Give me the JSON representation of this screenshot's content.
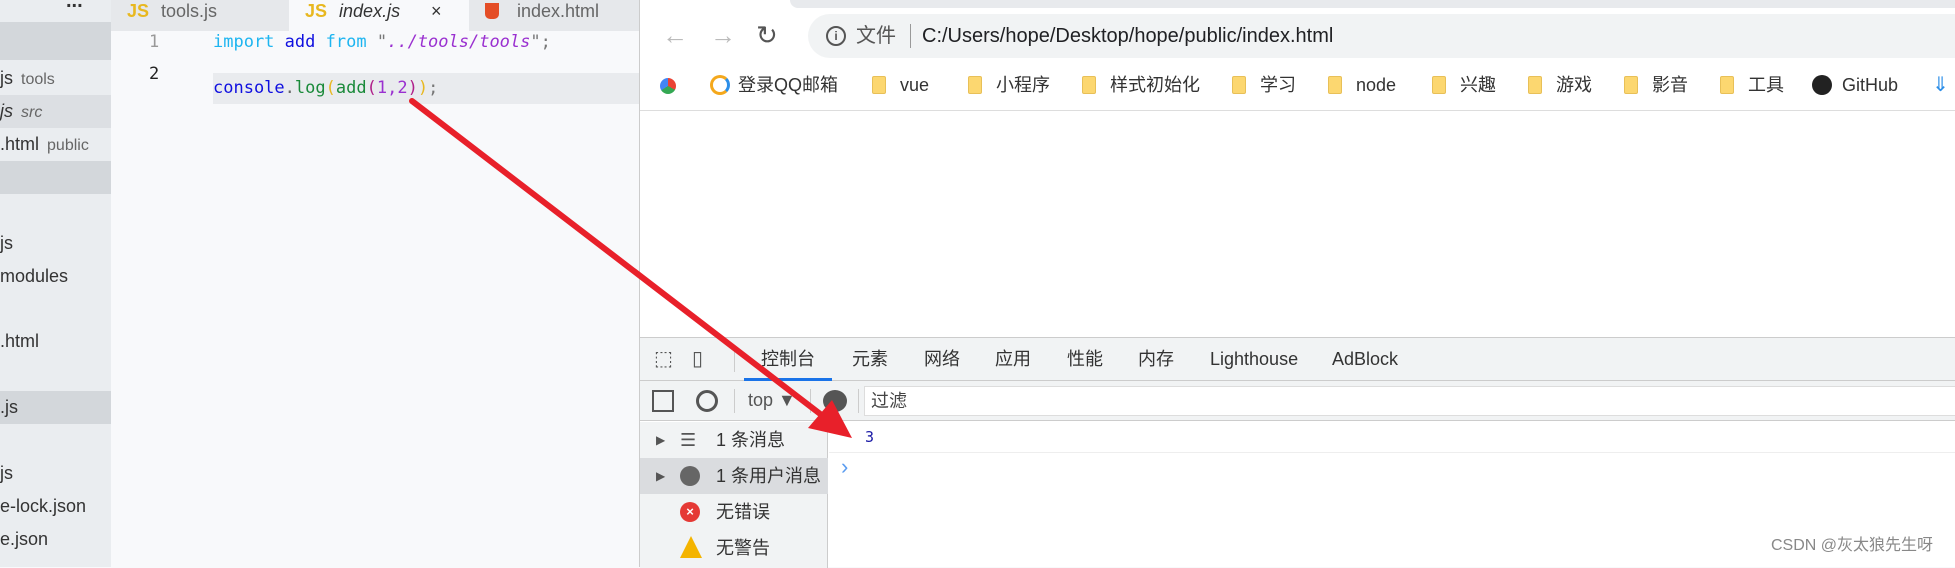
{
  "sidebar": {
    "items": [
      {
        "label": "js",
        "desc": "tools"
      },
      {
        "label": "js",
        "desc": "src"
      },
      {
        "label": ".html",
        "desc": "public"
      },
      {
        "label": "js",
        "desc": ""
      },
      {
        "label": "modules",
        "desc": ""
      },
      {
        "label": ".html",
        "desc": ""
      },
      {
        "label": ".js",
        "desc": ""
      },
      {
        "label": "js",
        "desc": ""
      },
      {
        "label": "e-lock.json",
        "desc": ""
      },
      {
        "label": "e.json",
        "desc": ""
      }
    ],
    "more": "..."
  },
  "editor": {
    "tabs": [
      {
        "icon": "JS",
        "label": "tools.js"
      },
      {
        "icon": "JS",
        "label": "index.js",
        "close": "×"
      },
      {
        "icon": "html5",
        "label": "index.html"
      }
    ],
    "lines": [
      {
        "num": "1"
      },
      {
        "num": "2"
      }
    ],
    "code": {
      "l1_kw": "import",
      "l1_id": "add",
      "l1_from": "from",
      "l1_q1": "\"",
      "l1_path": "../tools/tools",
      "l1_q2": "\";",
      "l2_obj": "console",
      "l2_dot": ".",
      "l2_fn": "log",
      "l2_p1": "(",
      "l2_add": "add",
      "l2_p2": "(",
      "l2_args": "1,2",
      "l2_p3": ")",
      "l2_p4": ")",
      "l2_semi": ";"
    }
  },
  "browser": {
    "address": {
      "security_label": "文件",
      "url": "C:/Users/hope/Desktop/hope/public/index.html"
    },
    "bookmarks": [
      {
        "label": "登录QQ邮箱",
        "icon": "qqmail-icon"
      },
      {
        "label": "vue",
        "icon": "folder"
      },
      {
        "label": "小程序",
        "icon": "folder"
      },
      {
        "label": "样式初始化",
        "icon": "folder"
      },
      {
        "label": "学习",
        "icon": "folder"
      },
      {
        "label": "node",
        "icon": "folder"
      },
      {
        "label": "兴趣",
        "icon": "folder"
      },
      {
        "label": "游戏",
        "icon": "folder"
      },
      {
        "label": "影音",
        "icon": "folder"
      },
      {
        "label": "工具",
        "icon": "folder"
      },
      {
        "label": "GitHub",
        "icon": "github-icon"
      }
    ]
  },
  "devtools": {
    "tabs": [
      "控制台",
      "元素",
      "网络",
      "应用",
      "性能",
      "内存",
      "Lighthouse",
      "AdBlock"
    ],
    "active_tab": "控制台",
    "context": "top ▼",
    "filter_placeholder": "过滤",
    "sidebar": [
      {
        "label": "1 条消息"
      },
      {
        "label": "1 条用户消息"
      },
      {
        "label": "无错误"
      },
      {
        "label": "无警告"
      }
    ],
    "output": [
      {
        "value": "3"
      }
    ],
    "prompt": "›"
  },
  "colors": {
    "accent": "#1a73e8",
    "arrow": "#e8202a",
    "error": "#e53935",
    "warning": "#f4b400"
  },
  "watermark": "CSDN @灰太狼先生呀"
}
